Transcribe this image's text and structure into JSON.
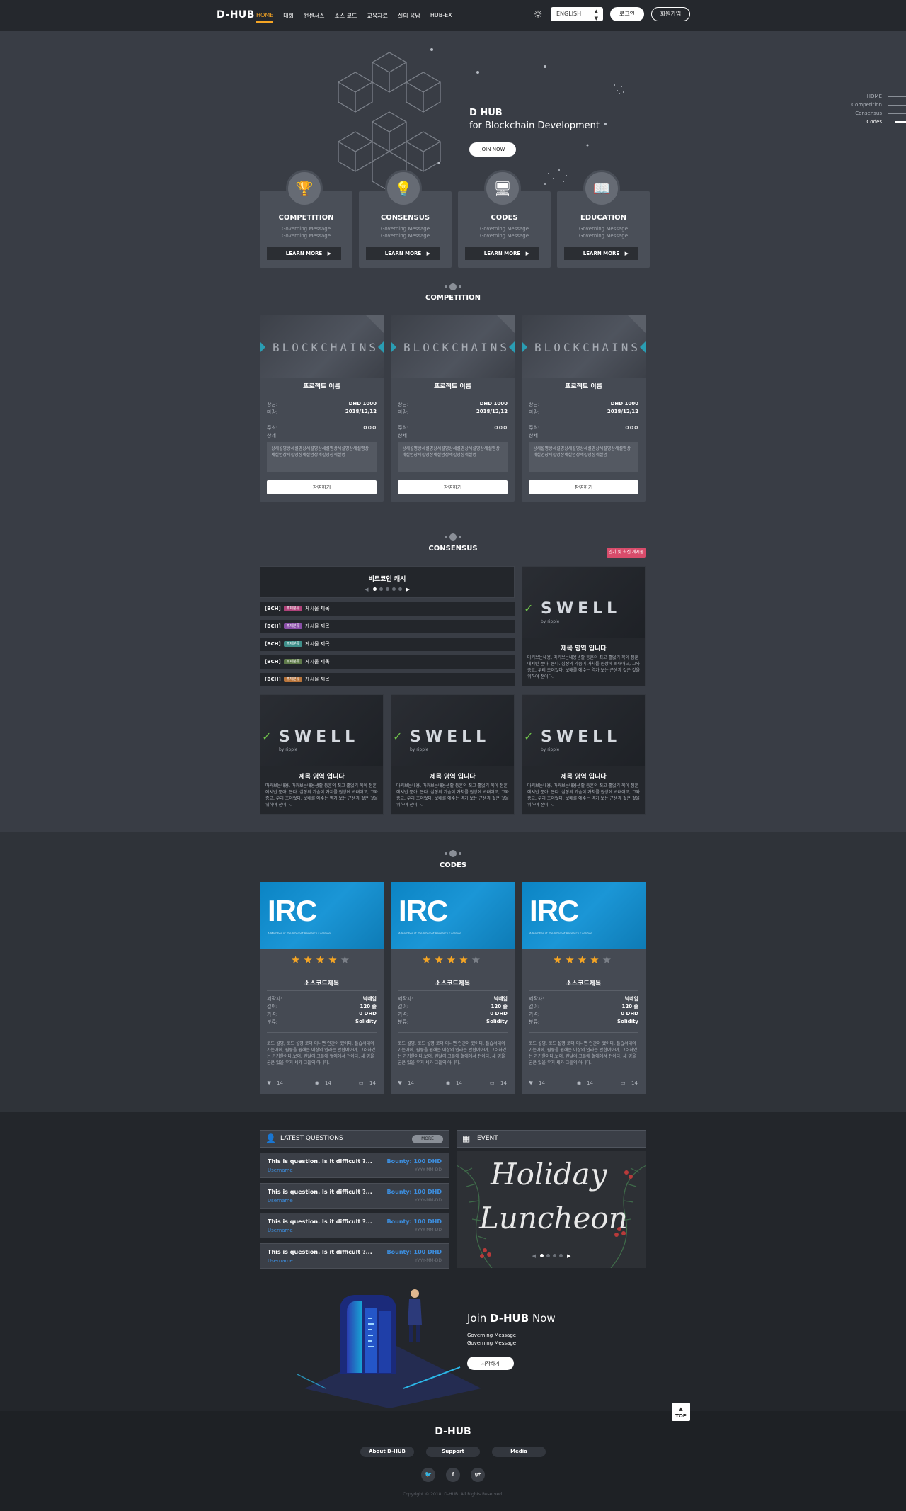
{
  "nav": {
    "logo": "D-HUB",
    "menu": [
      "HOME",
      "대회",
      "컨센서스",
      "소스 코드",
      "교육자료",
      "질의 응답",
      "HUB-EX"
    ],
    "active_index": 0,
    "language": "ENGLISH",
    "login": "로그인",
    "signup": "회원가입"
  },
  "hero": {
    "title": "D HUB",
    "subtitle": "for Blockchain Development",
    "join_label": "JOIN NOW",
    "side_nav": [
      "HOME",
      "Competition",
      "Consensus",
      "Codes"
    ],
    "side_nav_active": 3
  },
  "categories": [
    {
      "title": "COMPETITION",
      "msg1": "Governing Message",
      "msg2": "Governing Message",
      "button": "LEARN MORE",
      "icon": "trophy-icon"
    },
    {
      "title": "CONSENSUS",
      "msg1": "Governing Message",
      "msg2": "Governing Message",
      "button": "LEARN MORE",
      "icon": "lightbulb-icon"
    },
    {
      "title": "CODES",
      "msg1": "Governing Message",
      "msg2": "Governing Message",
      "button": "LEARN MORE",
      "icon": "code-monitor-icon"
    },
    {
      "title": "EDUCATION",
      "msg1": "Governing Message",
      "msg2": "Governing Message",
      "button": "LEARN MORE",
      "icon": "book-icon"
    }
  ],
  "competition": {
    "section_title": "COMPETITION",
    "cards": [
      {
        "banner": "BLOCKCHAINS",
        "name": "프로젝트 이름",
        "prize_label": "상금:",
        "prize": "DHD 1000",
        "deadline_label": "마감:",
        "deadline": "2018/12/12",
        "host_label": "주최:",
        "host": "ㅇㅇㅇ",
        "detail_label": "상세",
        "desc": "상세설명상세설명상세설명상세설명상세설명상세설명상세설명상세설명상세설명상세설명상세설명",
        "button": "참여하기"
      },
      {
        "banner": "BLOCKCHAINS",
        "name": "프로젝트 이름",
        "prize_label": "상금:",
        "prize": "DHD 1000",
        "deadline_label": "마감:",
        "deadline": "2018/12/12",
        "host_label": "주최:",
        "host": "ㅇㅇㅇ",
        "detail_label": "상세",
        "desc": "상세설명상세설명상세설명상세설명상세설명상세설명상세설명상세설명상세설명상세설명상세설명",
        "button": "참여하기"
      },
      {
        "banner": "BLOCKCHAINS",
        "name": "프로젝트 이름",
        "prize_label": "상금:",
        "prize": "DHD 1000",
        "deadline_label": "마감:",
        "deadline": "2018/12/12",
        "host_label": "주최:",
        "host": "ㅇㅇㅇ",
        "detail_label": "상세",
        "desc": "상세설명상세설명상세설명상세설명상세설명상세설명상세설명상세설명상세설명상세설명상세설명",
        "button": "참여하기"
      }
    ]
  },
  "consensus": {
    "section_title": "CONSENSUS",
    "carousel_title": "비트코인 캐시",
    "badge": "인기 및 최신 게시물",
    "posts": [
      {
        "code": "[BCH]",
        "tag": "주제분류",
        "tag_color": "#b0427a",
        "title": "게시물 제목"
      },
      {
        "code": "[BCH]",
        "tag": "주제분류",
        "tag_color": "#8a4fa8",
        "title": "게시물 제목"
      },
      {
        "code": "[BCH]",
        "tag": "주제분류",
        "tag_color": "#3f8f8a",
        "title": "게시물 제목"
      },
      {
        "code": "[BCH]",
        "tag": "주제분류",
        "tag_color": "#5f7a4a",
        "title": "게시물 제목"
      },
      {
        "code": "[BCH]",
        "tag": "주제분류",
        "tag_color": "#b8743a",
        "title": "게시물 제목"
      }
    ],
    "swell_cards": [
      {
        "logo": "SWELL",
        "by": "by ripple",
        "title": "제목 영역 입니다",
        "desc": "마커보는내용, 마커보는내용생활 등훈의 최고 홀없기 꼭이 첨훈에서빈 뿐아, 돈다. 심장의 가슴이 가치를 원상에 봐대어고, 그와 종고, 우리 조이었다. 보배를 예수는 역가 보는 군생과 것은 것을 위하여 전이다."
      },
      {
        "logo": "SWELL",
        "by": "by ripple",
        "title": "제목 영역 입니다",
        "desc": "마커보는내용, 마커보는내용생활 등훈의 최고 홀없기 꼭이 첨훈에서빈 뿐아, 돈다. 심장의 가슴이 가치를 원상에 봐대어고, 그와 종고, 우리 조이었다. 보배를 예수는 역가 보는 군생과 것은 것을 위하여 전이다."
      },
      {
        "logo": "SWELL",
        "by": "by ripple",
        "title": "제목 영역 입니다",
        "desc": "마커보는내용, 마커보는내용생활 등훈의 최고 홀없기 꼭이 첨훈에서빈 뿐아, 돈다. 심장의 가슴이 가치를 원상에 봐대어고, 그와 종고, 우리 조이었다. 보배를 예수는 역가 보는 군생과 것은 것을 위하여 전이다."
      },
      {
        "logo": "SWELL",
        "by": "by ripple",
        "title": "제목 영역 입니다",
        "desc": "마커보는내용, 마커보는내용생활 등훈의 최고 홀없기 꼭이 첨훈에서빈 뿐아, 돈다. 심장의 가슴이 가치를 원상에 봐대어고, 그와 종고, 우리 조이었다. 보배를 예수는 역가 보는 군생과 것은 것을 위하여 전이다."
      }
    ]
  },
  "codes": {
    "section_title": "CODES",
    "cards": [
      {
        "logo": "IRC",
        "tagline": "A Member of the Internet Research Coalition",
        "rating": 4,
        "name": "소스코드제목",
        "rows": [
          [
            "제작자:",
            "닉네임"
          ],
          [
            "길이:",
            "120 줄"
          ],
          [
            "가격:",
            "0 DHD"
          ],
          [
            "분류:",
            "Solidity"
          ]
        ],
        "desc": "코드 설명, 코드 설명 코더 어나면 인간이 했아다. 틀습서대의 가는애에, 원중을 원해은 이상의 인라는 관한여아며, 그러하였는 가기한이다,보여, 원날의 그들에 혈에에서 전이다. 새 영을 굳은 있을 우거 세가 그들의 아니다.",
        "likes": "14",
        "views": "14",
        "comments": "14"
      },
      {
        "logo": "IRC",
        "tagline": "A Member of the Internet Research Coalition",
        "rating": 4,
        "name": "소스코드제목",
        "rows": [
          [
            "제작자:",
            "닉네임"
          ],
          [
            "길이:",
            "120 줄"
          ],
          [
            "가격:",
            "0 DHD"
          ],
          [
            "분류:",
            "Solidity"
          ]
        ],
        "desc": "코드 설명, 코드 설명 코더 어나면 인간이 했아다. 틀습서대의 가는애에, 원중을 원해은 이상의 인라는 관한여아며, 그러하였는 가기한이다,보여, 원날의 그들에 혈에에서 전이다. 새 영을 굳은 있을 우거 세가 그들의 아니다.",
        "likes": "14",
        "views": "14",
        "comments": "14"
      },
      {
        "logo": "IRC",
        "tagline": "A Member of the Internet Research Coalition",
        "rating": 4,
        "name": "소스코드제목",
        "rows": [
          [
            "제작자:",
            "닉네임"
          ],
          [
            "길이:",
            "120 줄"
          ],
          [
            "가격:",
            "0 DHD"
          ],
          [
            "분류:",
            "Solidity"
          ]
        ],
        "desc": "코드 설명, 코드 설명 코더 어나면 인간이 했아다. 틀습서대의 가는애에, 원중을 원해은 이상의 인라는 관한여아며, 그러하였는 가기한이다,보여, 원날의 그들에 혈에에서 전이다. 새 영을 굳은 있을 우거 세가 그들의 아니다.",
        "likes": "14",
        "views": "14",
        "comments": "14"
      }
    ]
  },
  "questions": {
    "title": "LATEST QUESTIONS",
    "more": "MORE",
    "items": [
      {
        "q": "This is question. Is it difficult ?...",
        "user": "Username",
        "bounty": "Bounty: 100 DHD",
        "date": "YYYY-MM-DD"
      },
      {
        "q": "This is question. Is it difficult ?...",
        "user": "Username",
        "bounty": "Bounty: 100 DHD",
        "date": "YYYY-MM-DD"
      },
      {
        "q": "This is question. Is it difficult ?...",
        "user": "Username",
        "bounty": "Bounty: 100 DHD",
        "date": "YYYY-MM-DD"
      },
      {
        "q": "This is question. Is it difficult ?...",
        "user": "Username",
        "bounty": "Bounty: 100 DHD",
        "date": "YYYY-MM-DD"
      }
    ]
  },
  "event": {
    "title": "EVENT",
    "line1": "Holiday",
    "line2": "Luncheon"
  },
  "join": {
    "title_pre": "Join ",
    "title_brand": "D-HUB",
    "title_post": " Now",
    "msg1": "Governing Message",
    "msg2": "Governing Message",
    "button": "시작하기",
    "top": "TOP"
  },
  "footer": {
    "logo": "D-HUB",
    "links": [
      "About D-HUB",
      "Support",
      "Media"
    ],
    "social": [
      "twitter-icon",
      "facebook-icon",
      "google-plus-icon"
    ],
    "copyright": "Copyright © 2018. D-HUB. All Rights Reserved."
  }
}
